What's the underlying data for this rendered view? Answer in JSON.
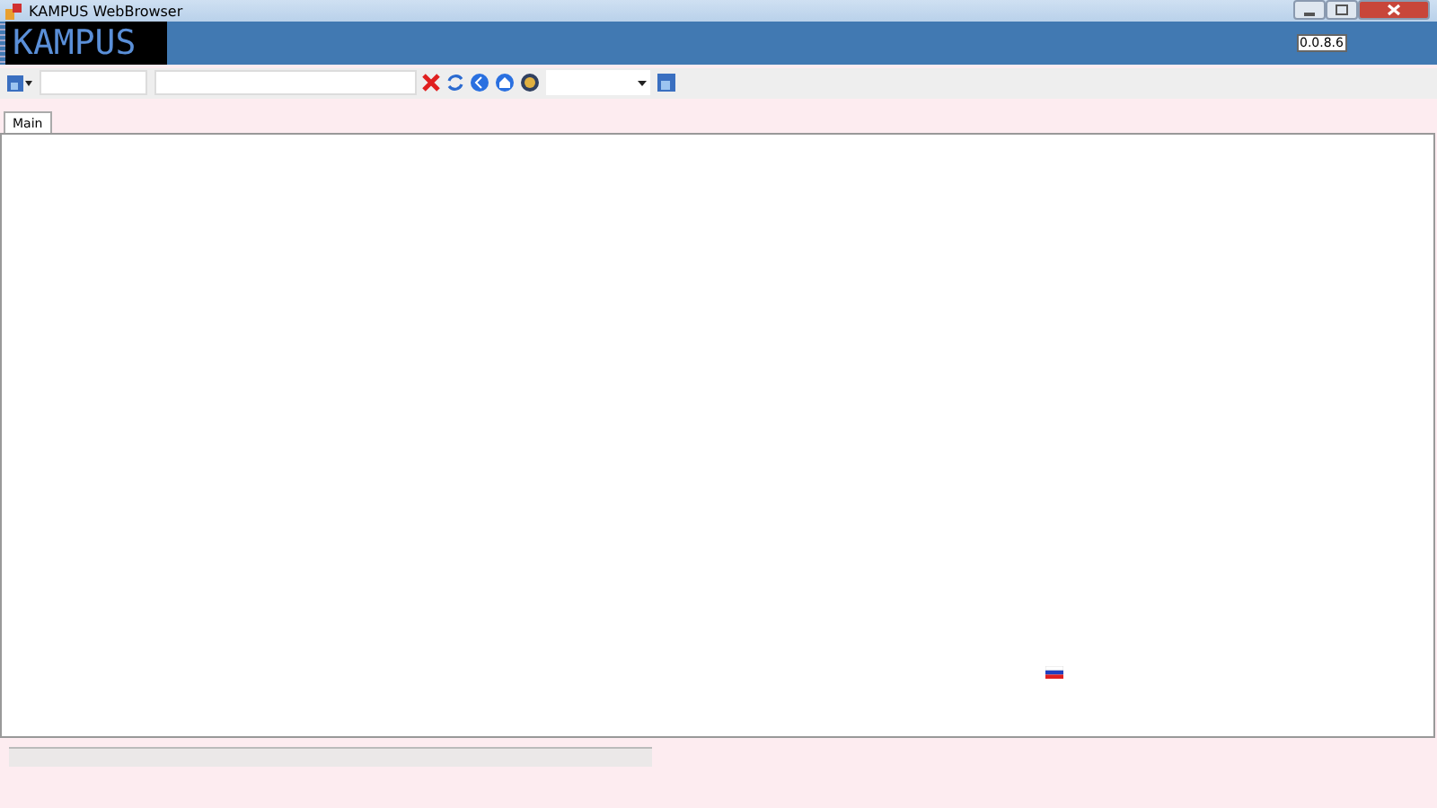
{
  "window": {
    "title": "KAMPUS WebBrowser"
  },
  "banner": {
    "logo": "KAMPUS",
    "version": "0.0.8.6"
  },
  "tabs": [
    {
      "label": "Main",
      "selected": true
    }
  ],
  "progress": {
    "level": 0
  }
}
